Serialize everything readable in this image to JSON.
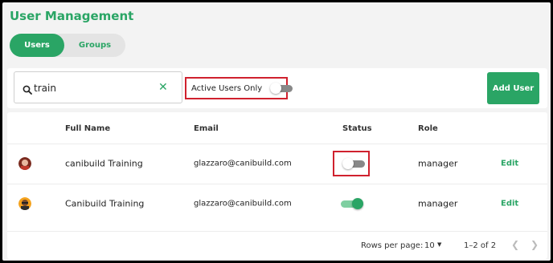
{
  "app": {
    "title": "User Management",
    "accent_color": "#2aa565",
    "highlight_color": "#d0212e"
  },
  "tabs": [
    {
      "label": "Users",
      "active": true
    },
    {
      "label": "Groups",
      "active": false
    }
  ],
  "toolbar": {
    "search_value": "train",
    "search_icon": "search-icon",
    "clear_icon": "close-icon",
    "active_only_label": "Active Users Only",
    "active_only_on": false,
    "add_user_label": "Add User"
  },
  "table": {
    "columns": {
      "full_name": "Full Name",
      "email": "Email",
      "status": "Status",
      "role": "Role"
    },
    "rows": [
      {
        "full_name": "canibuild Training",
        "email": "glazzaro@canibuild.com",
        "status_on": false,
        "role": "manager",
        "action": "Edit"
      },
      {
        "full_name": "Canibuild Training",
        "email": "glazzaro@canibuild.com",
        "status_on": true,
        "role": "manager",
        "action": "Edit"
      }
    ]
  },
  "pagination": {
    "rows_per_page_label": "Rows per page:",
    "rows_per_page": "10",
    "range": "1–2 of 2",
    "prev_icon": "chevron-left-icon",
    "next_icon": "chevron-right-icon"
  }
}
